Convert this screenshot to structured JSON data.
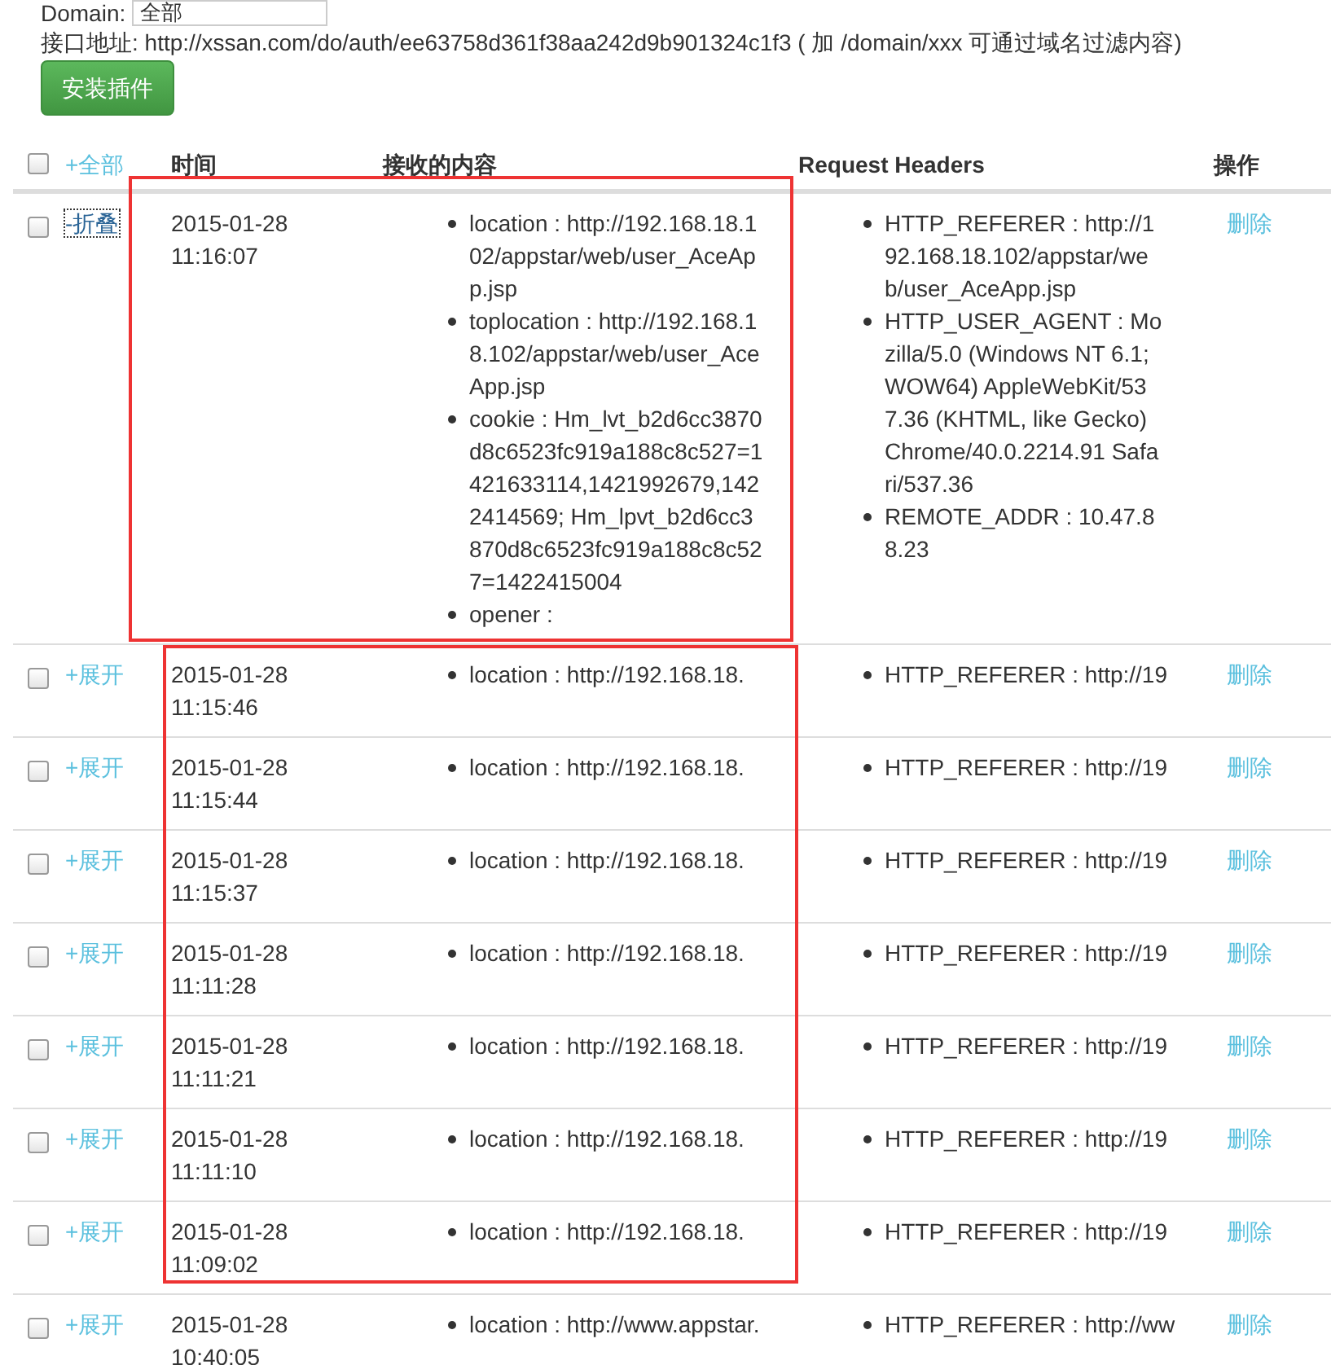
{
  "domain_filter": {
    "label": "Domain:",
    "value": "全部"
  },
  "api_address": "接口地址: http://xssan.com/do/auth/ee63758d361f38aa242d9b901324c1f3 ( 加 /domain/xxx 可通过域名过滤内容)",
  "install_button": "安装插件",
  "table": {
    "select_all": {
      "checked": false
    },
    "toggle_all": "+全部",
    "columns": [
      "时间",
      "接收的内容",
      "Request Headers",
      "操作"
    ],
    "rows": [
      {
        "checked": false,
        "expanded": true,
        "toggle": "-折叠",
        "time": [
          "2015-01-28",
          "11:16:07"
        ],
        "content": [
          "location : http://192.168.18.102/appstar/web/user_AceApp.jsp",
          "toplocation : http://192.168.18.102/appstar/web/user_AceApp.jsp",
          "cookie : Hm_lvt_b2d6cc3870d8c6523fc919a188c8c527=1421633114,1421992679,1422414569; Hm_lpvt_b2d6cc3870d8c6523fc919a188c8c527=1422415004",
          "opener :"
        ],
        "headers": [
          "HTTP_REFERER : http://192.168.18.102/appstar/web/user_AceApp.jsp",
          "HTTP_USER_AGENT : Mozilla/5.0 (Windows NT 6.1; WOW64) AppleWebKit/537.36 (KHTML, like Gecko) Chrome/40.0.2214.91 Safari/537.36",
          "REMOTE_ADDR : 10.47.88.23"
        ],
        "action": "删除"
      },
      {
        "checked": false,
        "expanded": false,
        "toggle": "+展开",
        "time": [
          "2015-01-28",
          "11:15:46"
        ],
        "content": [
          "location : http://192.168.18."
        ],
        "headers": [
          "HTTP_REFERER : http://19"
        ],
        "action": "删除"
      },
      {
        "checked": false,
        "expanded": false,
        "toggle": "+展开",
        "time": [
          "2015-01-28",
          "11:15:44"
        ],
        "content": [
          "location : http://192.168.18."
        ],
        "headers": [
          "HTTP_REFERER : http://19"
        ],
        "action": "删除"
      },
      {
        "checked": false,
        "expanded": false,
        "toggle": "+展开",
        "time": [
          "2015-01-28",
          "11:15:37"
        ],
        "content": [
          "location : http://192.168.18."
        ],
        "headers": [
          "HTTP_REFERER : http://19"
        ],
        "action": "删除"
      },
      {
        "checked": false,
        "expanded": false,
        "toggle": "+展开",
        "time": [
          "2015-01-28",
          "11:11:28"
        ],
        "content": [
          "location : http://192.168.18."
        ],
        "headers": [
          "HTTP_REFERER : http://19"
        ],
        "action": "删除"
      },
      {
        "checked": false,
        "expanded": false,
        "toggle": "+展开",
        "time": [
          "2015-01-28",
          "11:11:21"
        ],
        "content": [
          "location : http://192.168.18."
        ],
        "headers": [
          "HTTP_REFERER : http://19"
        ],
        "action": "删除"
      },
      {
        "checked": false,
        "expanded": false,
        "toggle": "+展开",
        "time": [
          "2015-01-28",
          "11:11:10"
        ],
        "content": [
          "location : http://192.168.18."
        ],
        "headers": [
          "HTTP_REFERER : http://19"
        ],
        "action": "删除"
      },
      {
        "checked": false,
        "expanded": false,
        "toggle": "+展开",
        "time": [
          "2015-01-28",
          "11:09:02"
        ],
        "content": [
          "location : http://192.168.18."
        ],
        "headers": [
          "HTTP_REFERER : http://19"
        ],
        "action": "删除"
      },
      {
        "checked": false,
        "expanded": false,
        "toggle": "+展开",
        "time": [
          "2015-01-28",
          "10:40:05"
        ],
        "content": [
          "location : http://www.appstar."
        ],
        "headers": [
          "HTTP_REFERER : http://ww"
        ],
        "action": "删除"
      }
    ]
  }
}
